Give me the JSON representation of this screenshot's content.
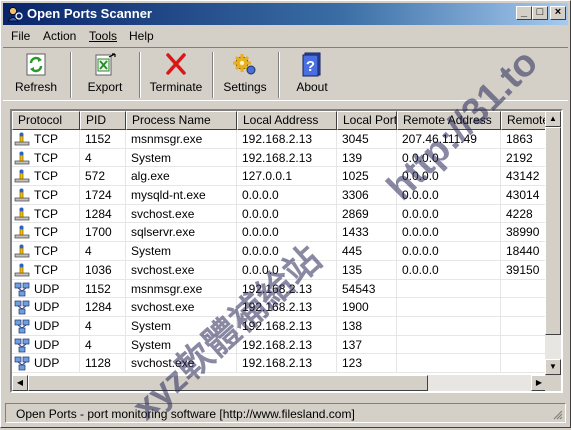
{
  "window": {
    "title": "Open Ports Scanner"
  },
  "menu": [
    "File",
    "Action",
    "Tools",
    "Help"
  ],
  "toolbar": {
    "refresh": "Refresh",
    "export": "Export",
    "terminate": "Terminate",
    "settings": "Settings",
    "about": "About"
  },
  "columns": [
    "Protocol",
    "PID",
    "Process Name",
    "Local Address",
    "Local Port",
    "Remote Address",
    "Remote"
  ],
  "rows": [
    [
      "TCP",
      "1152",
      "msnmsgr.exe",
      "192.168.2.13",
      "3045",
      "207.46.111.49",
      "1863"
    ],
    [
      "TCP",
      "4",
      "System",
      "192.168.2.13",
      "139",
      "0.0.0.0",
      "2192"
    ],
    [
      "TCP",
      "572",
      "alg.exe",
      "127.0.0.1",
      "1025",
      "0.0.0.0",
      "43142"
    ],
    [
      "TCP",
      "1724",
      "mysqld-nt.exe",
      "0.0.0.0",
      "3306",
      "0.0.0.0",
      "43014"
    ],
    [
      "TCP",
      "1284",
      "svchost.exe",
      "0.0.0.0",
      "2869",
      "0.0.0.0",
      "4228"
    ],
    [
      "TCP",
      "1700",
      "sqlservr.exe",
      "0.0.0.0",
      "1433",
      "0.0.0.0",
      "38990"
    ],
    [
      "TCP",
      "4",
      "System",
      "0.0.0.0",
      "445",
      "0.0.0.0",
      "18440"
    ],
    [
      "TCP",
      "1036",
      "svchost.exe",
      "0.0.0.0",
      "135",
      "0.0.0.0",
      "39150"
    ],
    [
      "UDP",
      "1152",
      "msnmsgr.exe",
      "192.168.2.13",
      "54543",
      "",
      ""
    ],
    [
      "UDP",
      "1284",
      "svchost.exe",
      "192.168.2.13",
      "1900",
      "",
      ""
    ],
    [
      "UDP",
      "4",
      "System",
      "192.168.2.13",
      "138",
      "",
      ""
    ],
    [
      "UDP",
      "4",
      "System",
      "192.168.2.13",
      "137",
      "",
      ""
    ],
    [
      "UDP",
      "1128",
      "svchost.exe",
      "192.168.2.13",
      "123",
      "",
      ""
    ]
  ],
  "status": "Open Ports - port monitoring software  [http://www.filesland.com]",
  "watermarks": {
    "url": "http://31.to",
    "site": "xyz軟體補給站"
  }
}
